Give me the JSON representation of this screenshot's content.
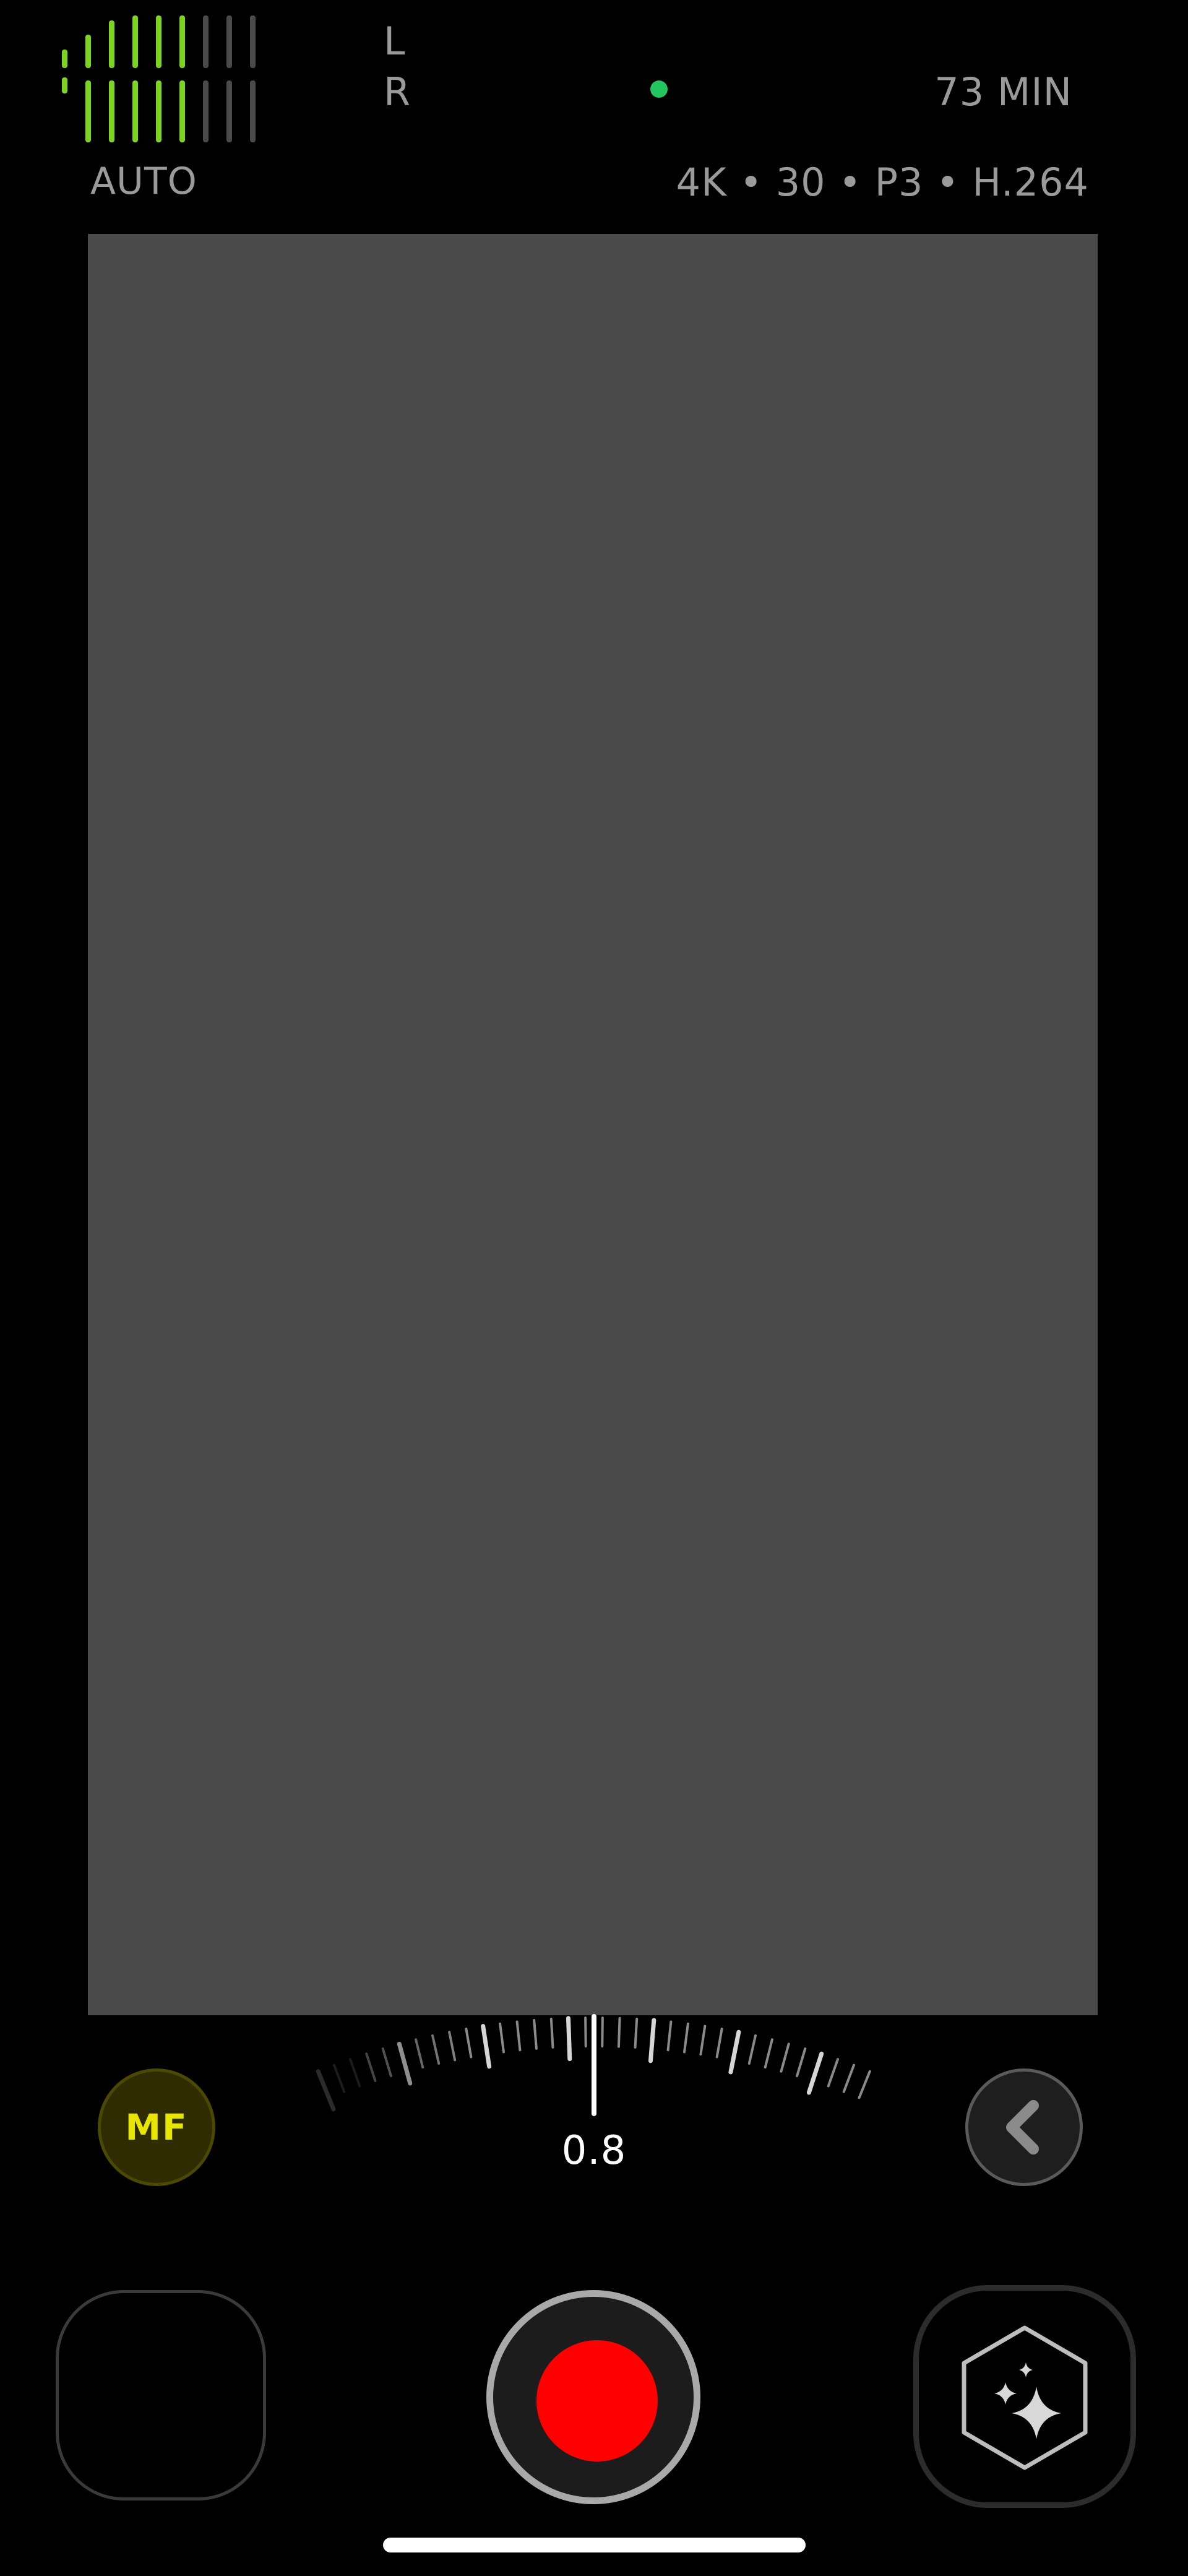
{
  "audio": {
    "left_label": "L",
    "right_label": "R",
    "left_level": 0.5,
    "right_level": 0.5,
    "active_color": "#7ed321",
    "inactive_color": "#4a4a4a"
  },
  "status": {
    "dot_color": "#22c55e",
    "time_remaining": "73 MIN"
  },
  "exposure": {
    "mode": "AUTO"
  },
  "format": {
    "info": "4K • 30 • P3 • H.264"
  },
  "viewfinder": {
    "color": "#4a4a4a"
  },
  "focus": {
    "mode_label": "MF",
    "mode_color": "#e8e600",
    "mode_bg": "#2e2c00",
    "value": "0.8"
  },
  "controls": {
    "record_color": "#ff0000"
  },
  "icons": {
    "collapse": "chevron-left-icon",
    "effects": "sparkles-hexagon-icon"
  }
}
